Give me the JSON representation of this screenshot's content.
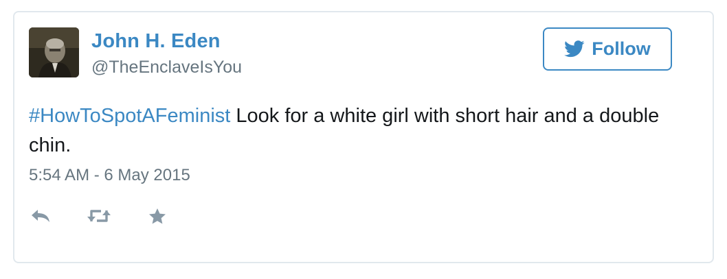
{
  "user": {
    "name": "John H. Eden",
    "handle": "@TheEnclaveIsYou"
  },
  "follow_button": {
    "label": "Follow",
    "icon": "twitter-bird-icon"
  },
  "tweet": {
    "hashtag": "#HowToSpotAFeminist",
    "body": " Look for a white girl with short hair and a double chin.",
    "timestamp": "5:54 AM - 6 May 2015"
  },
  "actions": [
    {
      "icon": "reply-icon"
    },
    {
      "icon": "retweet-icon"
    },
    {
      "icon": "favorite-star-icon"
    }
  ],
  "colors": {
    "accent": "#3b88c3",
    "muted": "#66757f",
    "text": "#14171a",
    "border": "#e1e8ed",
    "action_icon": "#8899a6"
  }
}
